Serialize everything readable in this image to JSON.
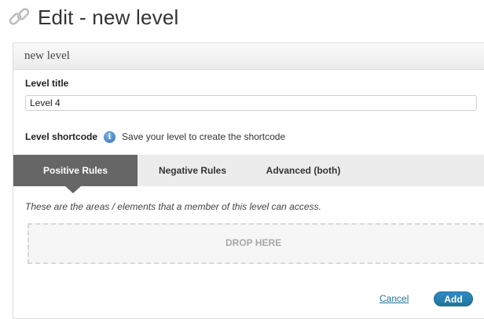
{
  "header": {
    "title": "Edit - new level",
    "icon": "link-chain-icon"
  },
  "panel": {
    "heading": "new level",
    "level_title_label": "Level title",
    "level_title_value": "Level 4",
    "shortcode_label": "Level shortcode",
    "shortcode_icon": "info-icon",
    "shortcode_message": "Save your level to create the shortcode"
  },
  "tabs": [
    {
      "label": "Positive Rules",
      "active": true
    },
    {
      "label": "Negative Rules",
      "active": false
    },
    {
      "label": "Advanced (both)",
      "active": false
    }
  ],
  "rules": {
    "description": "These are the areas / elements that a member of this level can access.",
    "drop_label": "DROP HERE"
  },
  "actions": {
    "cancel_label": "Cancel",
    "add_label": "Add"
  },
  "colors": {
    "accent": "#21759b",
    "active_tab": "#666666",
    "tab_bar": "#ececec"
  }
}
